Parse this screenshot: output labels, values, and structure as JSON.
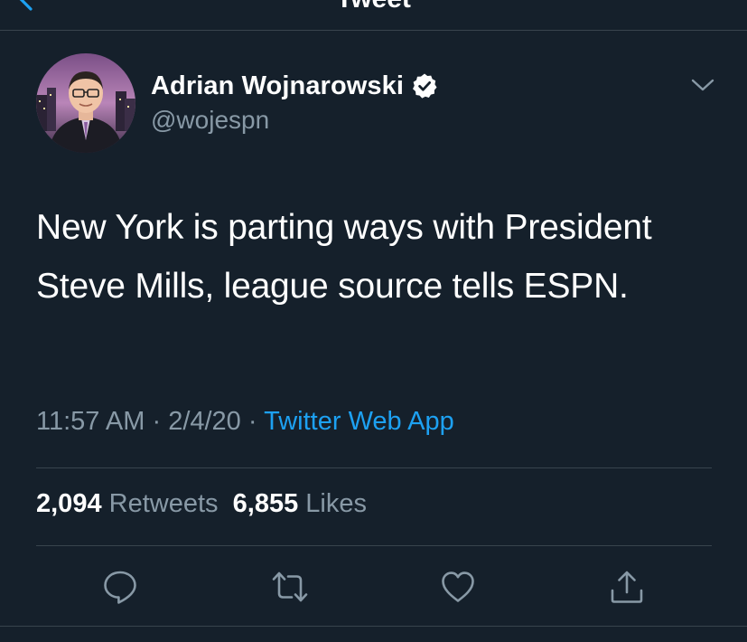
{
  "header": {
    "title": "Tweet"
  },
  "author": {
    "display_name": "Adrian Wojnarowski",
    "handle": "@wojespn",
    "verified": true
  },
  "tweet": {
    "text": "New York is parting ways with President Steve Mills, league source tells ESPN.",
    "time": "11:57 AM",
    "date": "2/4/20",
    "separator": "·",
    "source": "Twitter Web App"
  },
  "stats": {
    "retweets_count": "2,094",
    "retweets_label": "Retweets",
    "likes_count": "6,855",
    "likes_label": "Likes"
  },
  "actions": {
    "icons": [
      "reply-icon",
      "retweet-icon",
      "like-icon",
      "share-icon"
    ]
  },
  "colors": {
    "background": "#15202b",
    "text_primary": "#ffffff",
    "text_secondary": "#8899a6",
    "accent": "#1da1f2",
    "divider": "#38444d"
  }
}
